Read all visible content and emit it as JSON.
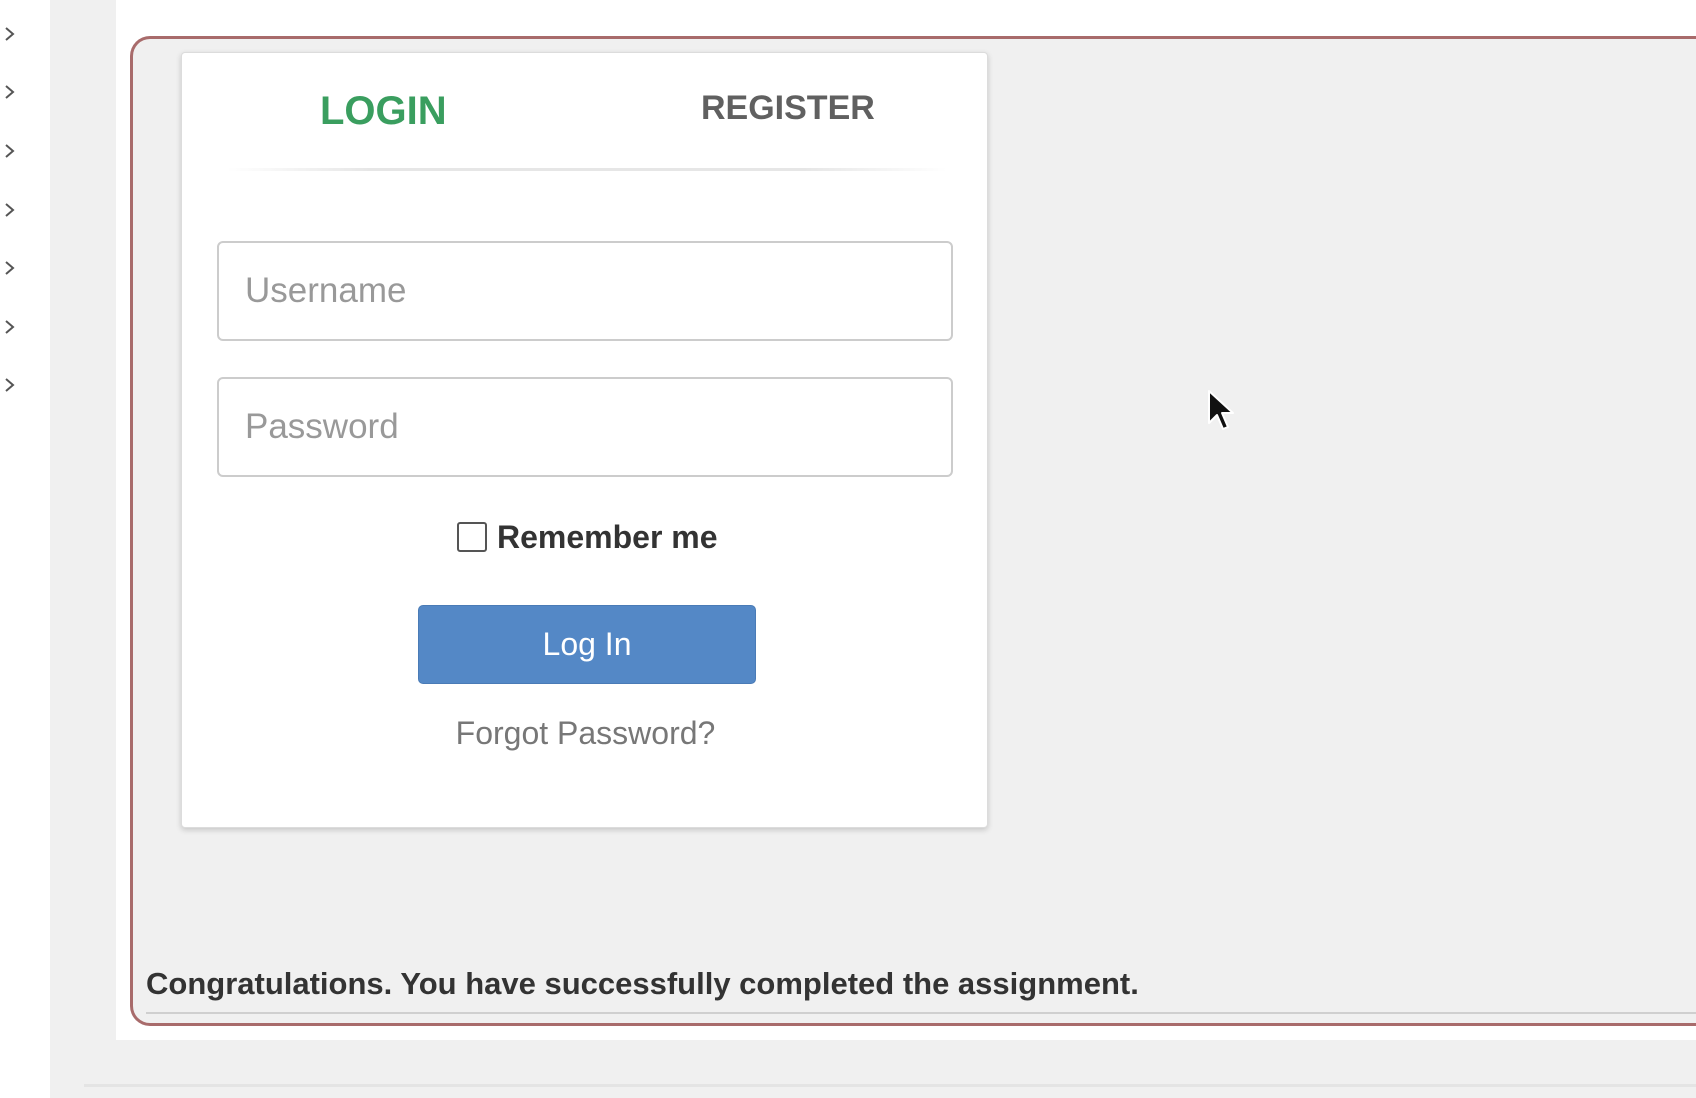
{
  "sidebar": {
    "items": [
      {
        "icon": "chevron-right-icon"
      },
      {
        "icon": "chevron-right-icon"
      },
      {
        "icon": "chevron-right-icon"
      },
      {
        "icon": "chevron-right-icon"
      },
      {
        "icon": "chevron-right-icon"
      },
      {
        "icon": "chevron-right-icon"
      },
      {
        "icon": "chevron-right-icon"
      }
    ]
  },
  "login_card": {
    "tabs": {
      "login_label": "LOGIN",
      "register_label": "REGISTER",
      "active": "LOGIN"
    },
    "username": {
      "placeholder": "Username",
      "value": ""
    },
    "password": {
      "placeholder": "Password",
      "value": ""
    },
    "remember_me": {
      "label": "Remember me",
      "checked": false
    },
    "submit_label": "Log In",
    "forgot_label": "Forgot Password?"
  },
  "assignment": {
    "message": "Congratulations. You have successfully completed the assignment."
  },
  "colors": {
    "active_tab": "#3a9e5f",
    "inactive_tab": "#606060",
    "primary_button": "#5488c6",
    "frame_border": "#a86b6b"
  }
}
